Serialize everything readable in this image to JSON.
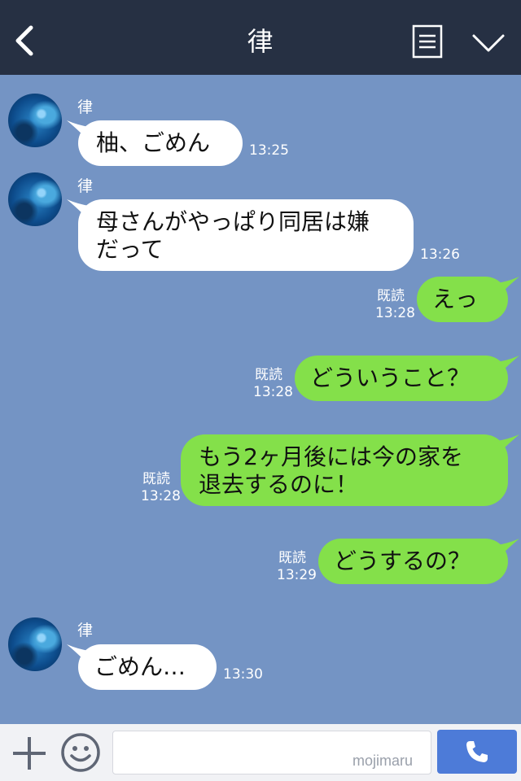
{
  "header": {
    "title": "律",
    "back_icon": "chevron-left-icon",
    "menu_icon": "notes-icon",
    "collapse_icon": "chevron-down-icon",
    "background": "#263043"
  },
  "chat": {
    "background": "#7494c4",
    "messages": [
      {
        "direction": "in",
        "sender": "律",
        "text": "柚、ごめん",
        "time": "13:25"
      },
      {
        "direction": "in",
        "sender": "律",
        "lines": [
          "母さんがやっぱり同居は嫌",
          "だって"
        ],
        "time": "13:26"
      },
      {
        "direction": "out",
        "text": "えっ",
        "read": "既読",
        "time": "13:28"
      },
      {
        "direction": "out",
        "text": "どういうこと？",
        "read": "既読",
        "time": "13:28"
      },
      {
        "direction": "out",
        "lines": [
          "もう2ヶ月後には今の家を",
          "退去するのに！"
        ],
        "read": "既読",
        "time": "13:28"
      },
      {
        "direction": "out",
        "text": "どうするの？",
        "read": "既読",
        "time": "13:29"
      },
      {
        "direction": "in",
        "sender": "律",
        "text": "ごめん…",
        "time": "13:30"
      }
    ]
  },
  "footer": {
    "plus_icon": "plus-icon",
    "emoji_icon": "smiley-icon",
    "input_value": "",
    "watermark": "mojimaru",
    "call_icon": "phone-icon",
    "call_color": "#4d7bd8"
  },
  "colors": {
    "incoming_bubble": "#ffffff",
    "outgoing_bubble": "#84e04a"
  }
}
